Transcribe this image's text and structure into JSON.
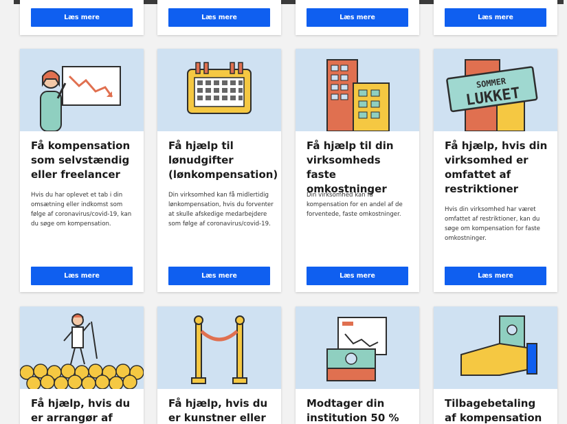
{
  "read_more_label": "Læs mere",
  "colors": {
    "accent": "#0f5ff0",
    "illustration_background": "#cfe1f2",
    "page_background": "#f2f2f2"
  },
  "cards_row1": [
    {
      "title": "Få kompensation som selvstændig eller freelancer",
      "description": "Hvis du har oplevet et tab i din omsætning eller indkomst som følge af coronavirus/covid-19, kan du søge om kompensation.",
      "icon": "person-presenting-declining-chart-icon"
    },
    {
      "title": "Få hjælp til lønudgifter (lønkompensation)",
      "description": "Din virksomhed kan få midlertidig lønkompensation, hvis du forventer at skulle afskedige medarbejdere som følge af coronavirus/covid-19.",
      "icon": "calendar-icon"
    },
    {
      "title": "Få hjælp til din virksomheds faste omkostninger",
      "description": "Din virksomhed kan få kompensation for en andel af de forventede, faste omkostninger.",
      "icon": "office-buildings-icon"
    },
    {
      "title": "Få hjælp, hvis din virksomhed er omfattet af restriktioner",
      "description": "Hvis din virksomhed har været omfattet af restriktioner, kan du søge om kompensation for faste omkostninger.",
      "icon": "closed-sign-building-icon",
      "sign_text_top": "SOMMER",
      "sign_text_bottom": "LUKKET"
    }
  ],
  "cards_row2": [
    {
      "title": "Få hjælp, hvis du er arrangør af større",
      "icon": "performer-crowd-icon"
    },
    {
      "title": "Få hjælp, hvis du er kunstner eller",
      "icon": "velvet-rope-icon"
    },
    {
      "title": "Modtager din institution 50 %",
      "icon": "money-chart-icon"
    },
    {
      "title": "Tilbagebetaling af kompensation",
      "icon": "hand-with-money-icon"
    }
  ]
}
